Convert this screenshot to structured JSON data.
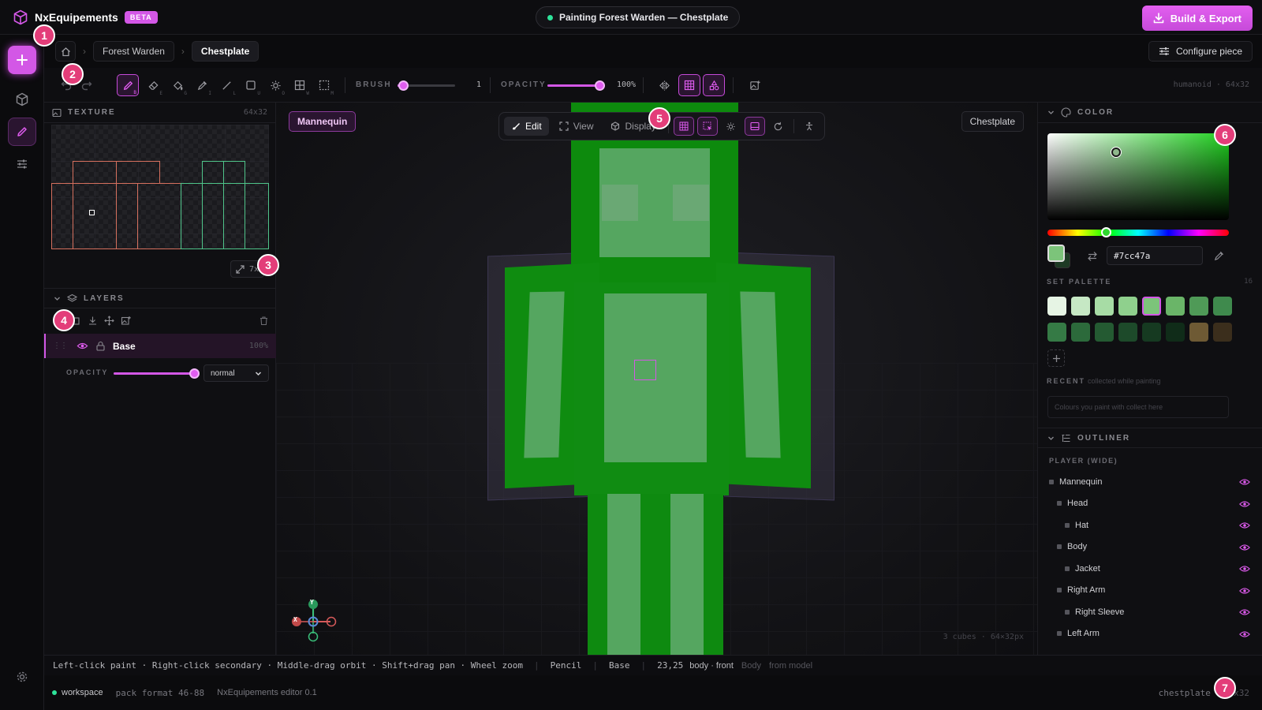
{
  "app": {
    "name": "NxEquipements",
    "badge": "BETA"
  },
  "status": {
    "text": "Painting Forest Warden — Chestplate",
    "color": "#2ee39a"
  },
  "header": {
    "build_label": "Build & Export",
    "accent": "#d357e6"
  },
  "breadcrumb": {
    "items": [
      "Forest Warden",
      "Chestplate"
    ]
  },
  "configure_label": "Configure piece",
  "toolbar": {
    "brush_label": "BRUSH",
    "brush_value": "1",
    "brush_level": 0.02,
    "opacity_label": "OPACITY",
    "opacity_value": "100%",
    "opacity_level": 1.0,
    "shortcuts": [
      "B",
      "E",
      "G",
      "I",
      "L",
      "U",
      "O",
      "W",
      "M"
    ],
    "meta": "humanoid · 64x32"
  },
  "texture_panel": {
    "title": "TEXTURE",
    "size": "64x32",
    "zoom": "7x"
  },
  "layers_panel": {
    "title": "LAYERS",
    "layer": {
      "name": "Base",
      "opacity": "100%"
    },
    "opacity_label": "OPACITY",
    "blend_mode": "normal"
  },
  "viewport": {
    "mode_tabs": [
      "Edit",
      "View",
      "Display"
    ],
    "mannequin_chip": "Mannequin",
    "piece_chip": "Chestplate",
    "info": "3 cubes · 64×32px",
    "axes": {
      "x": "X",
      "y": "Y"
    }
  },
  "color_panel": {
    "title": "COLOR",
    "hex_value": "#7cc47a",
    "primary": "#7cc47a",
    "secondary": "#1d3a24",
    "palette_label": "SET PALETTE",
    "palette_count": "16",
    "palette": [
      "#e6f4e4",
      "#c6e8c4",
      "#a7dca5",
      "#8fd08d",
      "#7cc47a",
      "#6ab568",
      "#4f9a57",
      "#3f8a4d",
      "#357a45",
      "#2c6a3b",
      "#245a32",
      "#1d4a2a",
      "#163a21",
      "#102c19",
      "#6e5a34",
      "#3b2e1c"
    ],
    "recent_label": "RECENT",
    "recent_hint": "collected while painting",
    "recent_placeholder": "Colours you paint with collect here"
  },
  "outliner": {
    "title": "OUTLINER",
    "group": "PLAYER (WIDE)",
    "items": [
      {
        "name": "Mannequin",
        "level": 0
      },
      {
        "name": "Head",
        "level": 1
      },
      {
        "name": "Hat",
        "level": 2
      },
      {
        "name": "Body",
        "level": 1
      },
      {
        "name": "Jacket",
        "level": 2
      },
      {
        "name": "Right Arm",
        "level": 1
      },
      {
        "name": "Right Sleeve",
        "level": 2
      },
      {
        "name": "Left Arm",
        "level": 1
      }
    ]
  },
  "statusbar": {
    "hints": "Left-click paint · Right-click secondary · Middle-drag orbit · Shift+drag pan · Wheel zoom",
    "tool": "Pencil",
    "layer": "Base",
    "coords": "23,25",
    "face": "body · front",
    "part": "Body",
    "source": "from model"
  },
  "footer": {
    "workspace": "workspace",
    "pack_format": "pack format 46-88",
    "version": "NxEquipements editor 0.1",
    "file": "chestplate",
    "size": "64x32"
  },
  "annotations": [
    "1",
    "2",
    "3",
    "4",
    "5",
    "6",
    "7"
  ]
}
